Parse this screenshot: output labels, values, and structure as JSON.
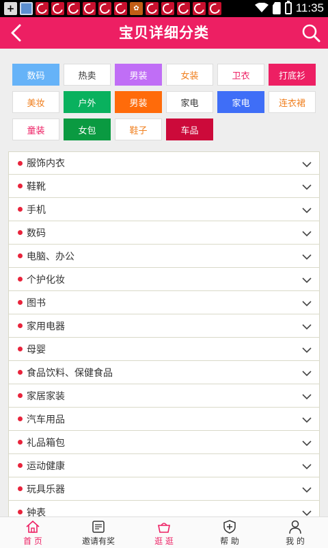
{
  "status_bar": {
    "time": "11:35"
  },
  "header": {
    "title": "宝贝详细分类"
  },
  "tags": [
    {
      "label": "数码",
      "bg": "#66b3f8",
      "color": "#ffffff"
    },
    {
      "label": "热卖",
      "bg": "#ffffff",
      "color": "#333333"
    },
    {
      "label": "男装",
      "bg": "#c06ef6",
      "color": "#ffffff"
    },
    {
      "label": "女装",
      "bg": "#ffffff",
      "color": "#f07f1e"
    },
    {
      "label": "卫衣",
      "bg": "#ffffff",
      "color": "#ed1f63"
    },
    {
      "label": "打底衫",
      "bg": "#ed1f63",
      "color": "#ffffff"
    },
    {
      "label": "美妆",
      "bg": "#ffffff",
      "color": "#f07f1e"
    },
    {
      "label": "户外",
      "bg": "#09b15e",
      "color": "#ffffff"
    },
    {
      "label": "男装",
      "bg": "#ff6b0a",
      "color": "#ffffff"
    },
    {
      "label": "家电",
      "bg": "#ffffff",
      "color": "#333333"
    },
    {
      "label": "家电",
      "bg": "#3f6ef7",
      "color": "#ffffff"
    },
    {
      "label": "连衣裙",
      "bg": "#ffffff",
      "color": "#f07f1e"
    },
    {
      "label": "童装",
      "bg": "#ffffff",
      "color": "#ed1f63"
    },
    {
      "label": "女包",
      "bg": "#0a9a41",
      "color": "#ffffff"
    },
    {
      "label": "鞋子",
      "bg": "#ffffff",
      "color": "#f07f1e"
    },
    {
      "label": "车品",
      "bg": "#cc0a3a",
      "color": "#ffffff"
    }
  ],
  "categories": [
    "服饰内衣",
    "鞋靴",
    "手机",
    "数码",
    "电脑、办公",
    "个护化妆",
    "图书",
    "家用电器",
    "母婴",
    "食品饮料、保健食品",
    "家居家装",
    "汽车用品",
    "礼品箱包",
    "运动健康",
    "玩具乐器",
    "钟表"
  ],
  "bottom_nav": [
    {
      "label": "首 页",
      "icon": "home-icon",
      "active": true
    },
    {
      "label": "邀请有奖",
      "icon": "invite-icon",
      "active": false
    },
    {
      "label": "逛 逛",
      "icon": "shopping-bag-icon",
      "active": true
    },
    {
      "label": "帮 助",
      "icon": "help-icon",
      "active": false
    },
    {
      "label": "我 的",
      "icon": "user-icon",
      "active": false
    }
  ],
  "colors": {
    "accent": "#ed1f63",
    "dot": "#e8243c"
  }
}
